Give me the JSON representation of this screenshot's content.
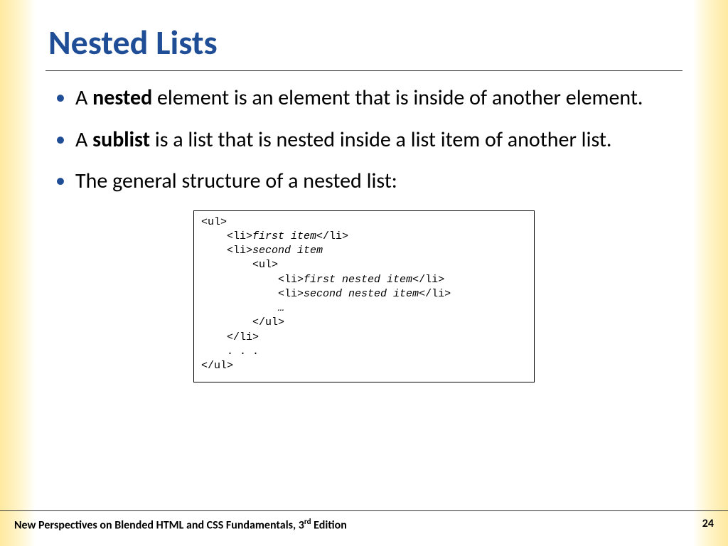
{
  "title": "Nested Lists",
  "bullets": {
    "b1_pre": "A ",
    "b1_bold": "nested",
    "b1_post": " element is an element that is inside of another element.",
    "b2_pre": "A ",
    "b2_bold": "sublist",
    "b2_post": " is a list that is nested inside a list item of another list.",
    "b3": "The general structure of a nested list:"
  },
  "code": {
    "l1": "<ul>",
    "l2a": "    <li>",
    "l2b": "first item",
    "l2c": "</li>",
    "l3a": "    <li>",
    "l3b": "second item",
    "l4": "        <ul>",
    "l5a": "            <li>",
    "l5b": "first nested item",
    "l5c": "</li>",
    "l6a": "            <li>",
    "l6b": "second nested item",
    "l6c": "</li>",
    "l7": "            …",
    "l8": "        </ul>",
    "l9": "    </li>",
    "l10": "    . . .",
    "l11": "</ul>"
  },
  "footer": {
    "book_pre": "New Perspectives on Blended HTML and CSS Fundamentals, 3",
    "book_sup": "rd",
    "book_post": " Edition",
    "page": "24"
  }
}
